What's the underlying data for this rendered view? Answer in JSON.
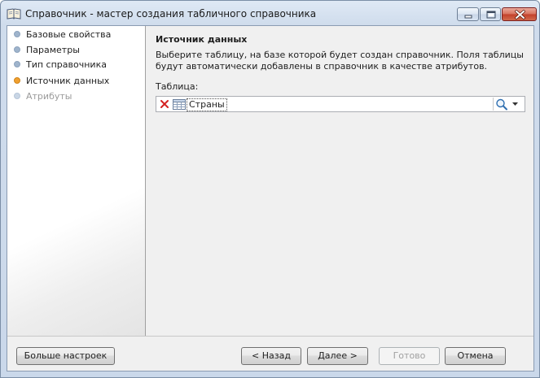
{
  "window": {
    "title": "Справочник - мастер создания табличного справочника"
  },
  "steps": [
    {
      "label": "Базовые свойства",
      "state": "done"
    },
    {
      "label": "Параметры",
      "state": "done"
    },
    {
      "label": "Тип справочника",
      "state": "done"
    },
    {
      "label": "Источник данных",
      "state": "active"
    },
    {
      "label": "Атрибуты",
      "state": "disabled"
    }
  ],
  "content": {
    "title": "Источник данных",
    "description": "Выберите таблицу, на базе которой будет создан справочник. Поля таблицы будут автоматически добавлены в справочник в качестве атрибутов.",
    "table_label": "Таблица:",
    "table_value": "Страны"
  },
  "buttons": {
    "more_settings": "Больше настроек",
    "back": "< Назад",
    "next": "Далее >",
    "finish": "Готово",
    "cancel": "Отмена"
  },
  "colors": {
    "active_step": "#f0a030",
    "step_bullet": "#9fb4cc",
    "close_button": "#c2402a"
  }
}
